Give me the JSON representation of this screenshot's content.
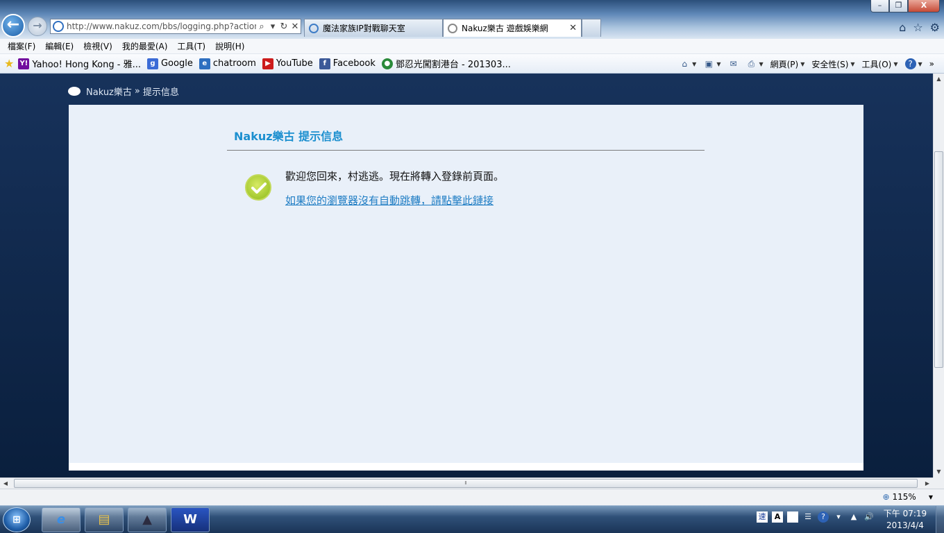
{
  "browser": {
    "window_controls": {
      "minimize": "–",
      "maximize": "❐",
      "close": "X"
    },
    "address": {
      "url": "http://www.nakuz.com/bbs/logging.php?action=login",
      "search_icon": "⌕",
      "refresh_icon": "↻",
      "stop_icon": "✕"
    },
    "tabs": [
      {
        "label": "魔法家族IP對戰聊天室",
        "icon": "ie-icon"
      },
      {
        "label": "Nakuz樂古 遊戲娛樂網",
        "icon": "loading-icon",
        "close": "✕"
      }
    ],
    "menu": [
      "檔案(F)",
      "編輯(E)",
      "檢視(V)",
      "我的最愛(A)",
      "工具(T)",
      "說明(H)"
    ],
    "favorites": [
      {
        "label": "Yahoo! Hong Kong - 雅...",
        "icon": "Y!",
        "color": "#720e9e"
      },
      {
        "label": "Google",
        "icon": "g",
        "color": "#3b6bd6"
      },
      {
        "label": "chatroom",
        "icon": "e",
        "color": "#2e6fc0"
      },
      {
        "label": "YouTube",
        "icon": "▶",
        "color": "#cc1b1b"
      },
      {
        "label": "Facebook",
        "icon": "f",
        "color": "#3b5998"
      },
      {
        "label": "鄧忍光闖割港台 - 201303...",
        "icon": "●",
        "color": "#2a8a3a"
      }
    ],
    "commands": {
      "page": "網頁(P)",
      "safety": "安全性(S)",
      "tools": "工具(O)",
      "overflow": "»"
    },
    "status": {
      "zoom": "115%"
    }
  },
  "page": {
    "breadcrumb": {
      "site": "Nakuz樂古",
      "separator": "»",
      "current": "提示信息"
    },
    "message_box": {
      "title": "Nakuz樂古 提示信息",
      "text": "歡迎您回來，村逃逃。現在將轉入登錄前頁面。",
      "link": "如果您的瀏覽器沒有自動跳轉，請點擊此鏈接"
    }
  },
  "taskbar": {
    "start": "⊞",
    "apps": [
      {
        "name": "internet-explorer",
        "glyph": "e",
        "color": "#3a8ee6"
      },
      {
        "name": "file-explorer",
        "glyph": "▤",
        "color": "#e9c24a"
      },
      {
        "name": "app-penguin",
        "glyph": "▲",
        "color": "#2c2c40"
      },
      {
        "name": "microsoft-word",
        "glyph": "W",
        "color": "#1a3e9b"
      }
    ],
    "tray": {
      "ime_mode": "速",
      "ime_font": "A",
      "help": "?",
      "volume": "🔊"
    },
    "clock": {
      "time": "下午 07:19",
      "date": "2013/4/4"
    }
  }
}
